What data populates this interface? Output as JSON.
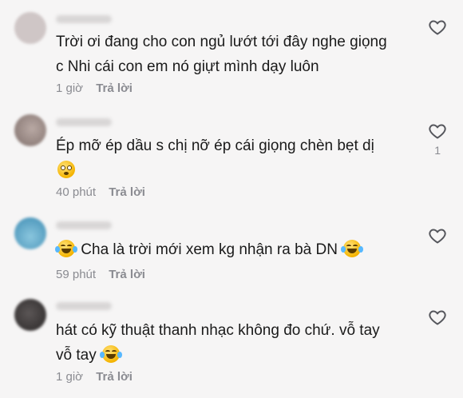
{
  "comments": [
    {
      "text_lines": [
        "Trời ơi đang cho con ngủ lướt tới đây nghe giọng",
        "c Nhi cái con em nó giựt mình dạy luôn"
      ],
      "time": "1 giờ",
      "reply_label": "Trả lời",
      "avatar_color": "#c9c0c0"
    },
    {
      "text_lines": [
        "Ép mỡ ép dầu s chị nỡ ép cái giọng chèn bẹt dị"
      ],
      "emoji": "flushed-face-icon",
      "time": "40 phút",
      "reply_label": "Trả lời",
      "like_count": "1",
      "avatar_color": "#9b8a86"
    },
    {
      "text_pre": "",
      "text_main": "Cha là trời mới xem kg nhận ra bà DN",
      "emoji_before": "laughing-tears-icon",
      "emoji_after": "laughing-tears-icon",
      "time": "59 phút",
      "reply_label": "Trả lời",
      "avatar_color": "#5ea7c8"
    },
    {
      "text_lines": [
        "hát có kỹ thuật thanh nhạc không đo chứ. vỗ tay",
        "vỗ tay"
      ],
      "emoji": "laughing-tears-icon",
      "time": "1 giờ",
      "reply_label": "Trả lời",
      "avatar_color": "#3b3838"
    }
  ]
}
